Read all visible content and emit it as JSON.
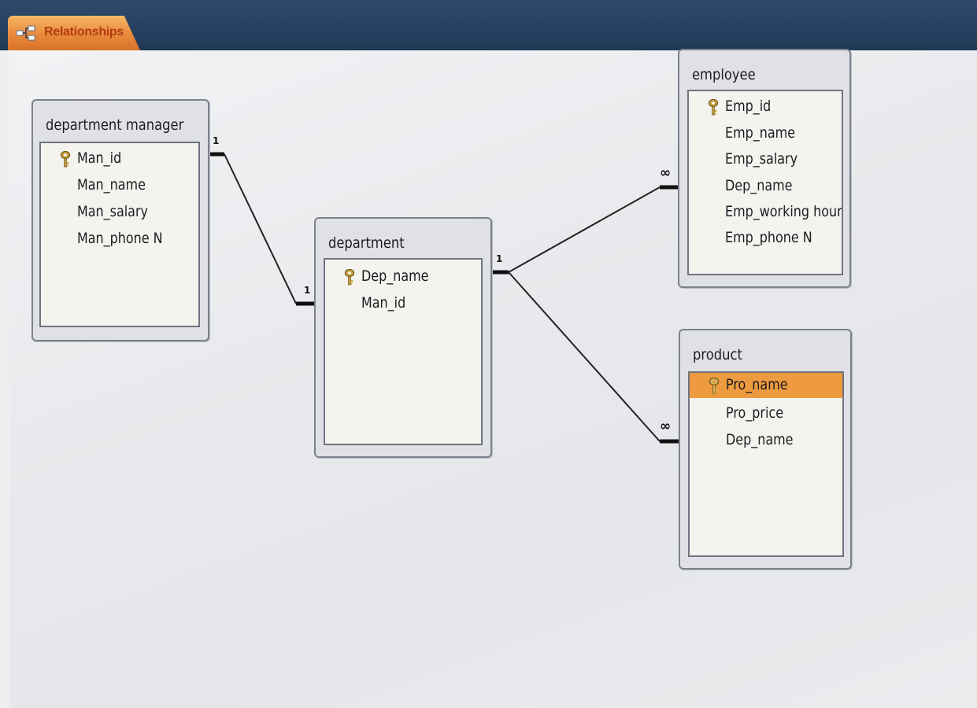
{
  "tab": {
    "label": "Relationships",
    "icon": "relationships-icon"
  },
  "tables": {
    "department_manager": {
      "title": "department manager",
      "fields": [
        "Man_id",
        "Man_name",
        "Man_salary",
        "Man_phone N"
      ],
      "primary_key": "Man_id"
    },
    "department": {
      "title": "department",
      "fields": [
        "Dep_name",
        "Man_id"
      ],
      "primary_key": "Dep_name"
    },
    "employee": {
      "title": "employee",
      "fields": [
        "Emp_id",
        "Emp_name",
        "Emp_salary",
        "Dep_name",
        "Emp_working hour",
        "Emp_phone N"
      ],
      "primary_key": "Emp_id"
    },
    "product": {
      "title": "product",
      "fields": [
        "Pro_name",
        "Pro_price",
        "Dep_name"
      ],
      "primary_key": "Pro_name",
      "selected_field": "Pro_name"
    }
  },
  "relationships": [
    {
      "from": "department manager",
      "to": "department",
      "from_label": "1",
      "to_label": "1"
    },
    {
      "from": "department",
      "to": "employee",
      "from_label": "1",
      "to_label": "∞"
    },
    {
      "from": "department",
      "to": "product",
      "from_label": "1",
      "to_label": "∞"
    }
  ],
  "colors": {
    "tab_bg": "#e8893a",
    "tab_text": "#b33b11",
    "selected_field": "#ee9a3e",
    "header_strip": "#25405f"
  }
}
